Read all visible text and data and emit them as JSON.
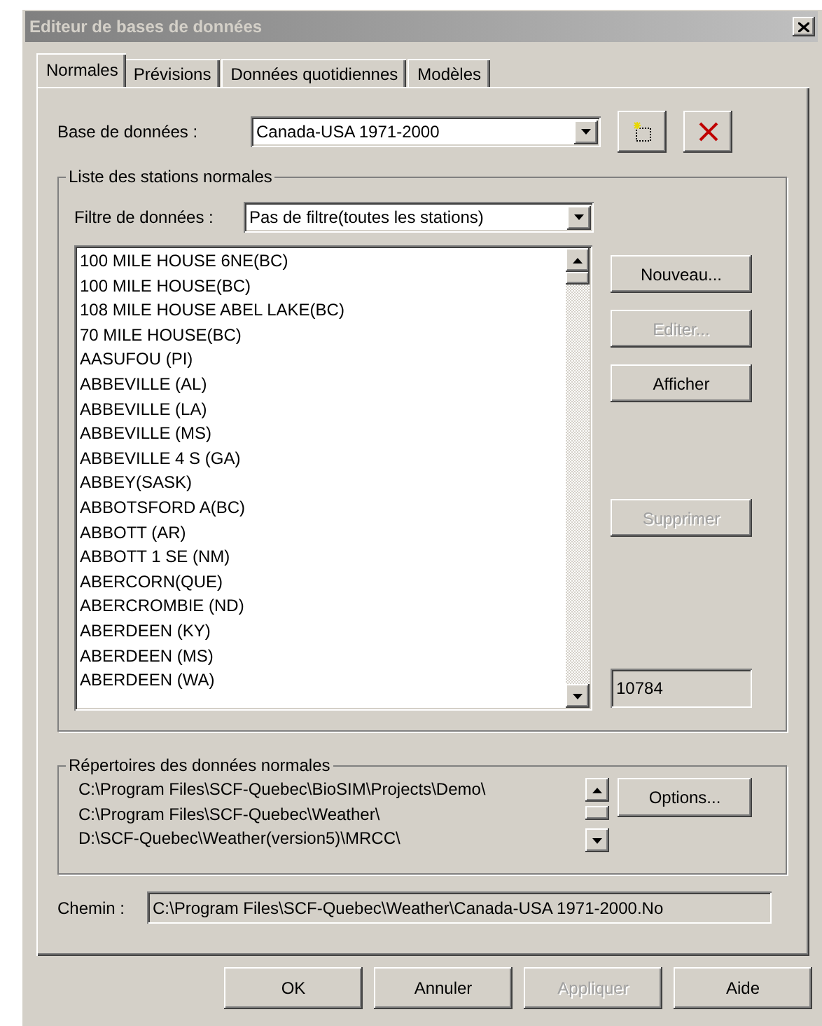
{
  "window": {
    "title": "Editeur de bases de données"
  },
  "tabs": [
    {
      "label": "Normales",
      "selected": true
    },
    {
      "label": "Prévisions",
      "selected": false
    },
    {
      "label": "Données quotidiennes",
      "selected": false
    },
    {
      "label": "Modèles",
      "selected": false
    }
  ],
  "database": {
    "label": "Base de données :",
    "value": "Canada-USA 1971-2000"
  },
  "stations_group": {
    "title": "Liste des stations normales",
    "filter": {
      "label": "Filtre de données :",
      "value": "Pas de filtre(toutes les stations)"
    },
    "stations": [
      "100 MILE HOUSE 6NE(BC)",
      "100 MILE HOUSE(BC)",
      "108 MILE HOUSE ABEL LAKE(BC)",
      "70 MILE HOUSE(BC)",
      "AASUFOU (PI)",
      "ABBEVILLE (AL)",
      "ABBEVILLE (LA)",
      "ABBEVILLE (MS)",
      "ABBEVILLE 4 S (GA)",
      "ABBEY(SASK)",
      "ABBOTSFORD A(BC)",
      "ABBOTT (AR)",
      "ABBOTT 1 SE (NM)",
      "ABERCORN(QUE)",
      "ABERCROMBIE (ND)",
      "ABERDEEN (KY)",
      "ABERDEEN (MS)",
      "ABERDEEN (WA)"
    ],
    "buttons": [
      {
        "label": "Nouveau...",
        "disabled": false
      },
      {
        "label": "Editer...",
        "disabled": true
      },
      {
        "label": "Afficher",
        "disabled": false
      },
      {
        "label": "Supprimer",
        "disabled": true
      }
    ],
    "count": "10784"
  },
  "directories_group": {
    "title": "Répertoires des données normales",
    "paths": [
      "C:\\Program Files\\SCF-Quebec\\BioSIM\\Projects\\Demo\\",
      "C:\\Program Files\\SCF-Quebec\\Weather\\",
      "D:\\SCF-Quebec\\Weather(version5)\\MRCC\\"
    ],
    "options_button": "Options..."
  },
  "path": {
    "label": "Chemin :",
    "value": "C:\\Program Files\\SCF-Quebec\\Weather\\Canada-USA 1971-2000.No"
  },
  "buttons": [
    {
      "label": "OK",
      "disabled": false
    },
    {
      "label": "Annuler",
      "disabled": false
    },
    {
      "label": "Appliquer",
      "disabled": true
    },
    {
      "label": "Aide",
      "disabled": false
    }
  ]
}
